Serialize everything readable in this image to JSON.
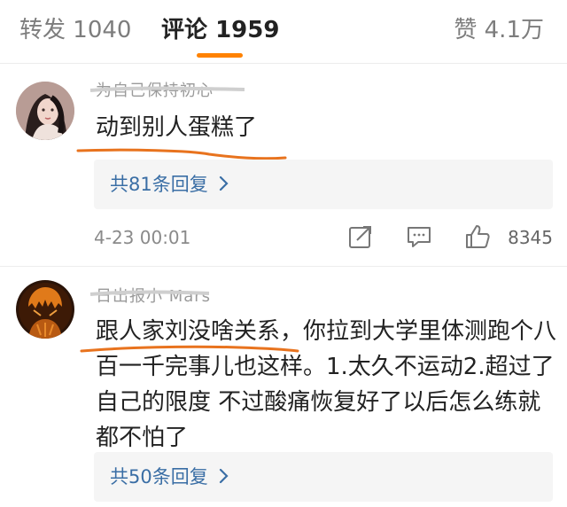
{
  "tabs": {
    "repost": {
      "label": "转发",
      "count": "1040"
    },
    "comment": {
      "label": "评论",
      "count": "1959"
    },
    "like": {
      "label": "赞",
      "count": "4.1万"
    }
  },
  "colors": {
    "accent": "#ff8200",
    "link": "#3a6ea5",
    "highlight_underline": "#e8731e"
  },
  "comments": [
    {
      "username": "为自己保持初心",
      "text": "动到别人蛋糕了",
      "reply_link": "共81条回复",
      "time": "4-23 00:01",
      "likes": "8345"
    },
    {
      "username": "日出报小 Mars",
      "text": "跟人家刘没啥关系，你拉到大学里体测跑个八百一千完事儿也这样。1.太久不运动2.超过了自己的限度 不过酸痛恢复好了以后怎么练就都不怕了",
      "reply_link": "共50条回复"
    }
  ],
  "icons": [
    "chevron-right-icon",
    "share-icon",
    "comment-icon",
    "thumbs-up-icon"
  ]
}
